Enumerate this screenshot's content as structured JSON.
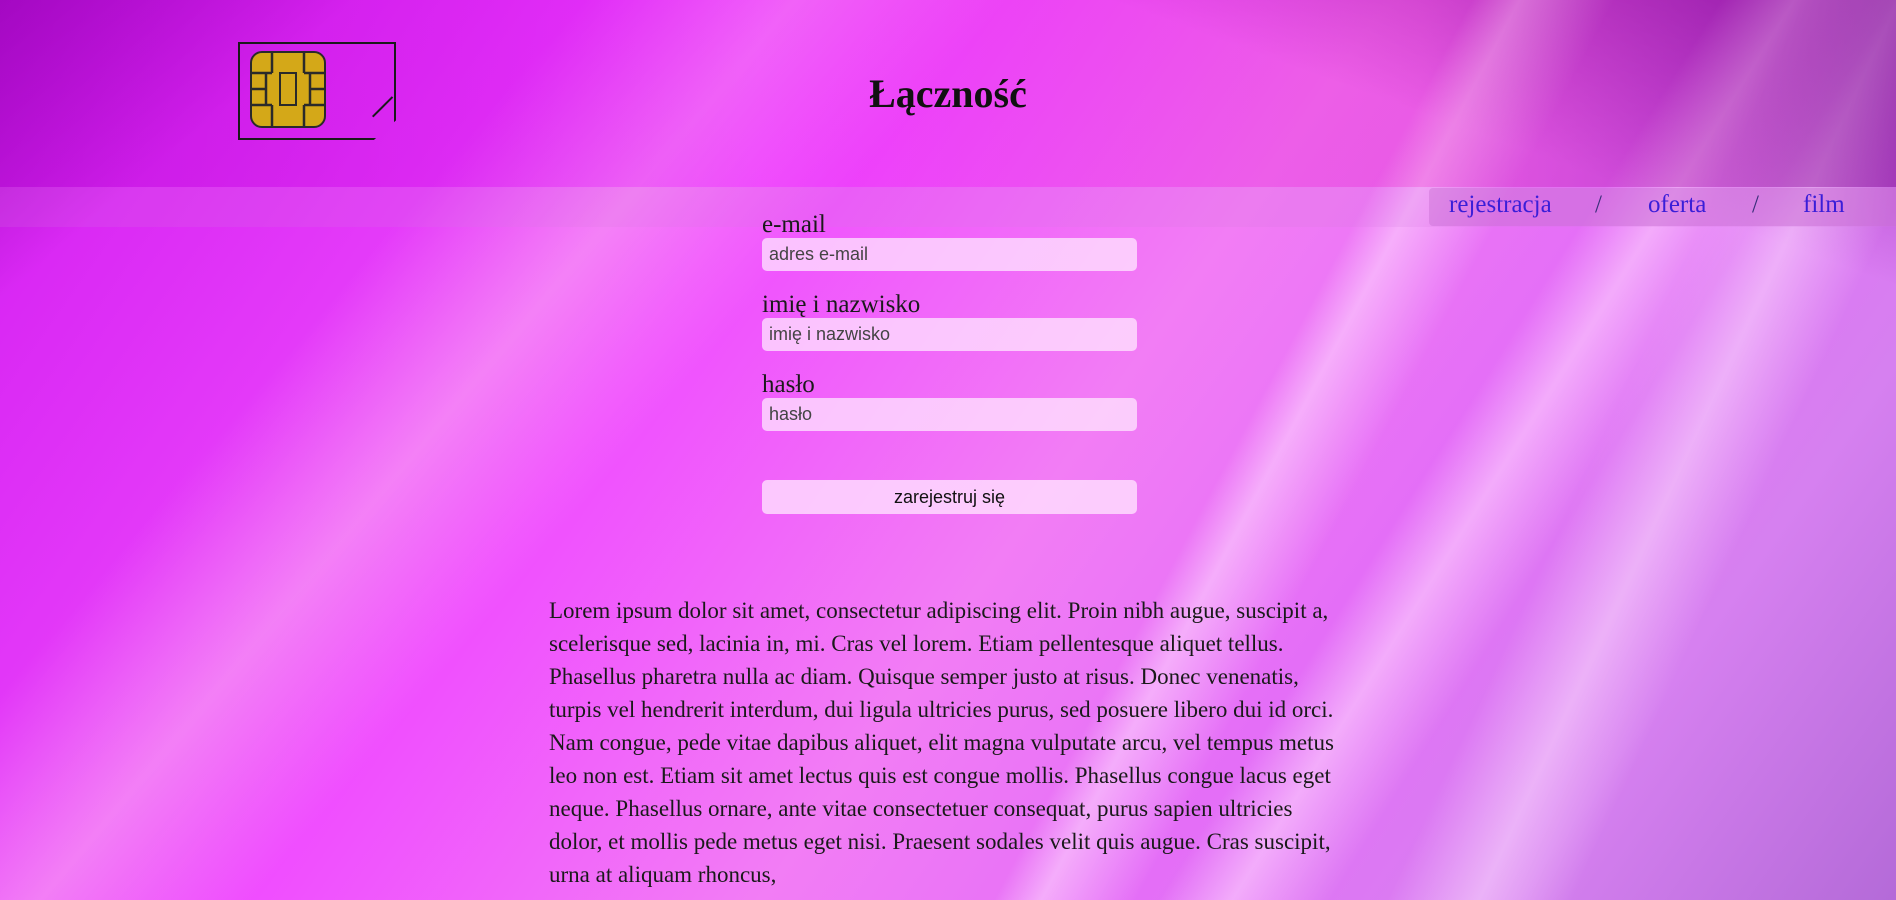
{
  "header": {
    "title": "Łączność",
    "logo_icon": "sim-card-icon"
  },
  "nav": {
    "items": [
      {
        "label": "rejestracja"
      },
      {
        "label": "oferta"
      },
      {
        "label": "film"
      }
    ],
    "separator": "/"
  },
  "form": {
    "email": {
      "label": "e-mail",
      "placeholder": "adres e-mail"
    },
    "name": {
      "label": "imię i nazwisko",
      "placeholder": "imię i nazwisko"
    },
    "password": {
      "label": "hasło",
      "placeholder": "hasło"
    },
    "submit_label": "zarejestruj się"
  },
  "content": {
    "paragraph": "Lorem ipsum dolor sit amet, consectetur adipiscing elit. Proin nibh augue, suscipit a, scelerisque sed, lacinia in, mi. Cras vel lorem. Etiam pellentesque aliquet tellus. Phasellus pharetra nulla ac diam. Quisque semper justo at risus. Donec venenatis, turpis vel hendrerit interdum, dui ligula ultricies purus, sed posuere libero dui id orci. Nam congue, pede vitae dapibus aliquet, elit magna vulputate arcu, vel tempus metus leo non est. Etiam sit amet lectus quis est congue mollis. Phasellus congue lacus eget neque. Phasellus ornare, ante vitae consectetuer consequat, purus sapien ultricies dolor, et mollis pede metus eget nisi. Praesent sodales velit quis augue. Cras suscipit, urna at aliquam rhoncus,"
  },
  "colors": {
    "background": "#f04dff",
    "nav_link": "#3a1ed8",
    "chip": "#d4a818"
  }
}
